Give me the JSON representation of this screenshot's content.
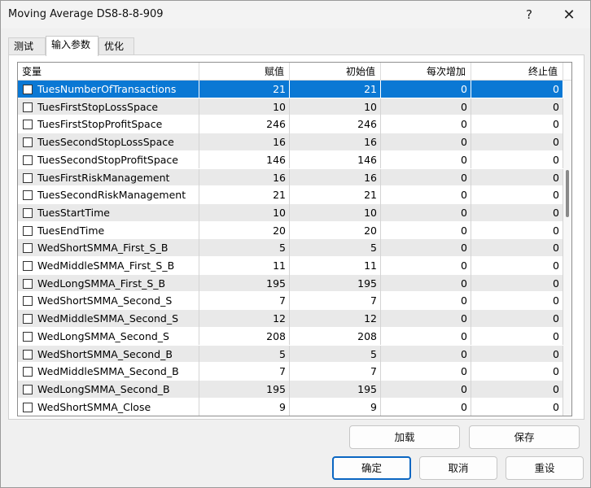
{
  "window": {
    "title": "Moving Average DS8-8-8-909",
    "help_glyph": "?",
    "close_glyph": "✕"
  },
  "tabs": [
    {
      "label": "测试",
      "active": false
    },
    {
      "label": "输入参数",
      "active": true
    },
    {
      "label": "优化",
      "active": false
    }
  ],
  "grid": {
    "columns": [
      "变量",
      "赋值",
      "初始值",
      "每次增加",
      "终止值"
    ],
    "rows": [
      {
        "name": "TuesNumberOfTransactions",
        "value": "21",
        "initial": "21",
        "step": "0",
        "stop": "0",
        "selected": true
      },
      {
        "name": "TuesFirstStopLossSpace",
        "value": "10",
        "initial": "10",
        "step": "0",
        "stop": "0"
      },
      {
        "name": "TuesFirstStopProfitSpace",
        "value": "246",
        "initial": "246",
        "step": "0",
        "stop": "0"
      },
      {
        "name": "TuesSecondStopLossSpace",
        "value": "16",
        "initial": "16",
        "step": "0",
        "stop": "0"
      },
      {
        "name": "TuesSecondStopProfitSpace",
        "value": "146",
        "initial": "146",
        "step": "0",
        "stop": "0"
      },
      {
        "name": "TuesFirstRiskManagement",
        "value": "16",
        "initial": "16",
        "step": "0",
        "stop": "0"
      },
      {
        "name": "TuesSecondRiskManagement",
        "value": "21",
        "initial": "21",
        "step": "0",
        "stop": "0"
      },
      {
        "name": "TuesStartTime",
        "value": "10",
        "initial": "10",
        "step": "0",
        "stop": "0"
      },
      {
        "name": "TuesEndTime",
        "value": "20",
        "initial": "20",
        "step": "0",
        "stop": "0"
      },
      {
        "name": "WedShortSMMA_First_S_B",
        "value": "5",
        "initial": "5",
        "step": "0",
        "stop": "0"
      },
      {
        "name": "WedMiddleSMMA_First_S_B",
        "value": "11",
        "initial": "11",
        "step": "0",
        "stop": "0"
      },
      {
        "name": "WedLongSMMA_First_S_B",
        "value": "195",
        "initial": "195",
        "step": "0",
        "stop": "0"
      },
      {
        "name": "WedShortSMMA_Second_S",
        "value": "7",
        "initial": "7",
        "step": "0",
        "stop": "0"
      },
      {
        "name": "WedMiddleSMMA_Second_S",
        "value": "12",
        "initial": "12",
        "step": "0",
        "stop": "0"
      },
      {
        "name": "WedLongSMMA_Second_S",
        "value": "208",
        "initial": "208",
        "step": "0",
        "stop": "0"
      },
      {
        "name": "WedShortSMMA_Second_B",
        "value": "5",
        "initial": "5",
        "step": "0",
        "stop": "0"
      },
      {
        "name": "WedMiddleSMMA_Second_B",
        "value": "7",
        "initial": "7",
        "step": "0",
        "stop": "0"
      },
      {
        "name": "WedLongSMMA_Second_B",
        "value": "195",
        "initial": "195",
        "step": "0",
        "stop": "0"
      },
      {
        "name": "WedShortSMMA_Close",
        "value": "9",
        "initial": "9",
        "step": "0",
        "stop": "0"
      }
    ]
  },
  "buttons": {
    "load": "加载",
    "save": "保存",
    "ok": "确定",
    "cancel": "取消",
    "reset": "重设"
  },
  "colors": {
    "selection": "#0a78d4",
    "default_button_border": "#0a66c2"
  }
}
